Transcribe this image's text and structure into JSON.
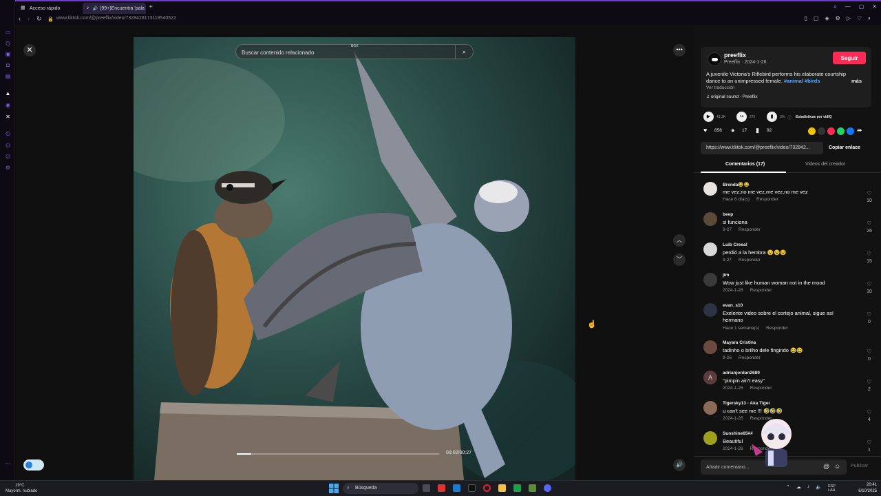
{
  "browser": {
    "tabs": [
      {
        "label": "Acceso rápido",
        "active": false
      },
      {
        "label": "(99+)Encuentra 'pala",
        "active": true
      }
    ],
    "url": "www.tiktok.com/@preeflix/video/7328428173119540522",
    "accent_color": "#6d3ad6"
  },
  "video": {
    "search_placeholder": "Buscar contenido relacionado",
    "badge": "BGX",
    "time": "00:02/00:27",
    "progress": 0.07
  },
  "creator": {
    "name": "preeflix",
    "subtitle": "Preeflix · 2024-1-26",
    "follow_label": "Seguir",
    "description": "A juvenile Victoria's Riflebird performs his elaborate courtship dance to an unimpressed female.",
    "hashtags": "#animal #birds",
    "more_label": "más",
    "translate_label": "Ver traducción",
    "sound": "original sound - Preeflix",
    "follow_color": "#fe2c55"
  },
  "stats": {
    "plays": "43.3K",
    "shares_top": "272",
    "ratio": "3%",
    "vidiq_label": "Estadísticas por vidIQ",
    "likes": "856",
    "comments": "17",
    "saves": "92"
  },
  "share": {
    "link": "https://www.tiktok.com/@preeflix/video/732842...",
    "copy_label": "Copiar enlace"
  },
  "panel_tabs": {
    "comments_label": "Comentarios (17)",
    "creator_videos_label": "Videos del creador"
  },
  "comments": [
    {
      "user": "Brenda😂😂",
      "text": "me vez,no me vez,me vez,no me vez",
      "date": "Hace 6 día(s)",
      "reply": "Responder",
      "likes": "10"
    },
    {
      "user": "beep",
      "text": "si funciona",
      "date": "9-27",
      "reply": "Responder",
      "likes": "26"
    },
    {
      "user": "Luib Creea!",
      "text": "perdió a la hembra 😵😵😵",
      "date": "9-27",
      "reply": "Responder",
      "likes": "15"
    },
    {
      "user": "jim",
      "text": "Wow just like human woman not in the mood",
      "date": "2024-1-26",
      "reply": "Responder",
      "likes": "10"
    },
    {
      "user": "evan_s10",
      "text": "Exelente video sobre el cortejo animal, sigue así hermano",
      "date": "Hace 1 semana(s)",
      "reply": "Responder",
      "likes": "0"
    },
    {
      "user": "Mayara Cristina",
      "text": "tadinho o brilho dele fingindo 😂😂",
      "date": "9-26",
      "reply": "Responder",
      "likes": "0"
    },
    {
      "user": "adrianjordan2689",
      "text": "\"pimpin ain't easy\"",
      "date": "2024-1-26",
      "reply": "Responder",
      "likes": "2",
      "initial": "A"
    },
    {
      "user": "Tigersky13 - Aka Tiger",
      "text": "u can't see me !!! 🤣🤣🤣",
      "date": "2024-1-26",
      "reply": "Responder",
      "likes": "4"
    },
    {
      "user": "Sunshine65##",
      "text": "Beautiful",
      "date": "2024-1-26",
      "reply": "Responder",
      "likes": "1"
    }
  ],
  "comment_box": {
    "placeholder": "Añadir comentario...",
    "publish_label": "Publicar"
  },
  "taskbar": {
    "temp": "19°C",
    "weather": "Mayorm. nublado",
    "search_label": "Búsqueda",
    "lang": "ESP",
    "lang_region": "LAA",
    "time": "20:41",
    "date": "6/10/2025"
  }
}
